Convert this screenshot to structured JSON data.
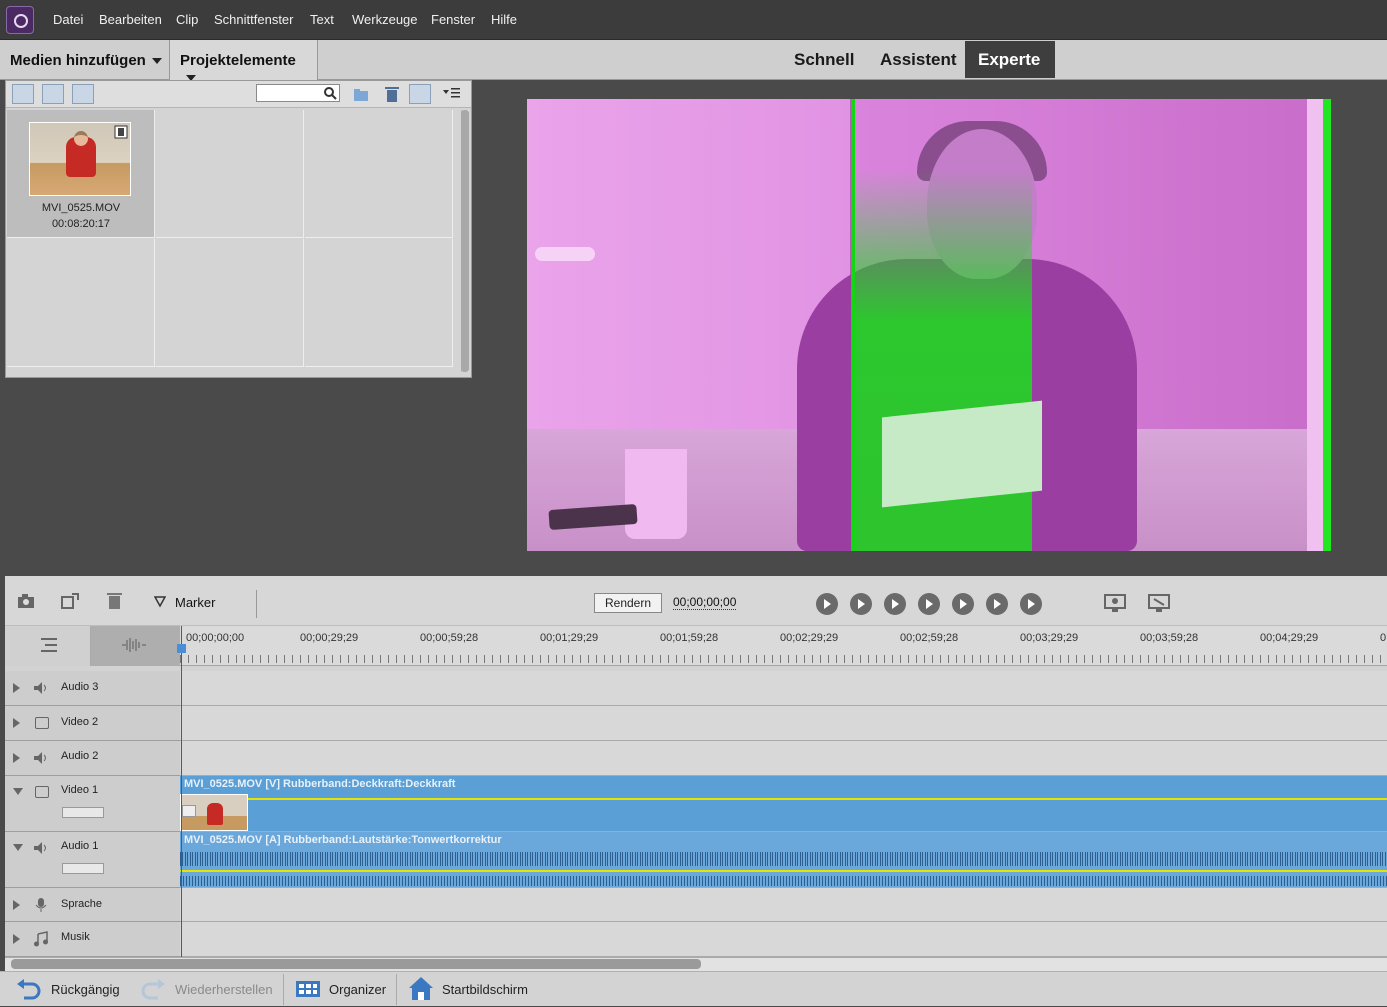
{
  "menu": [
    "Datei",
    "Bearbeiten",
    "Clip",
    "Schnittfenster",
    "Text",
    "Werkzeuge",
    "Fenster",
    "Hilfe"
  ],
  "topbar": {
    "add_media": "Medien hinzufügen",
    "project_assets": "Projektelemente",
    "modes": [
      "Schnell",
      "Assistent",
      "Experte"
    ],
    "active_mode": "Experte"
  },
  "media": {
    "search_value": "",
    "clip": {
      "name": "MVI_0525.MOV",
      "duration": "00:08:20:17"
    }
  },
  "timeline_toolbar": {
    "marker_label": "Marker",
    "render_label": "Rendern",
    "timecode": "00;00;00;00"
  },
  "ruler": [
    "00;00;00;00",
    "00;00;29;29",
    "00;00;59;28",
    "00;01;29;29",
    "00;01;59;28",
    "00;02;29;29",
    "00;02;59;28",
    "00;03;29;29",
    "00;03;59;28",
    "00;04;29;29",
    "0"
  ],
  "tracks": [
    "Audio 3",
    "Video 2",
    "Audio 2",
    "Video 1",
    "Audio 1",
    "Sprache",
    "Musik"
  ],
  "clips": {
    "video": "MVI_0525.MOV [V] Rubberband:Deckkraft:Deckkraft",
    "audio": "MVI_0525.MOV [A] Rubberband:Lautstärke:Tonwertkorrektur"
  },
  "bottom": {
    "undo": "Rückgängig",
    "redo": "Wiederherstellen",
    "organizer": "Organizer",
    "home": "Startbildschirm"
  },
  "colors": {
    "clip_video": "#5a9fd6",
    "clip_audio": "#6aa7da",
    "rubberband": "#e4e400",
    "preview_tint": "#e48ee6"
  }
}
